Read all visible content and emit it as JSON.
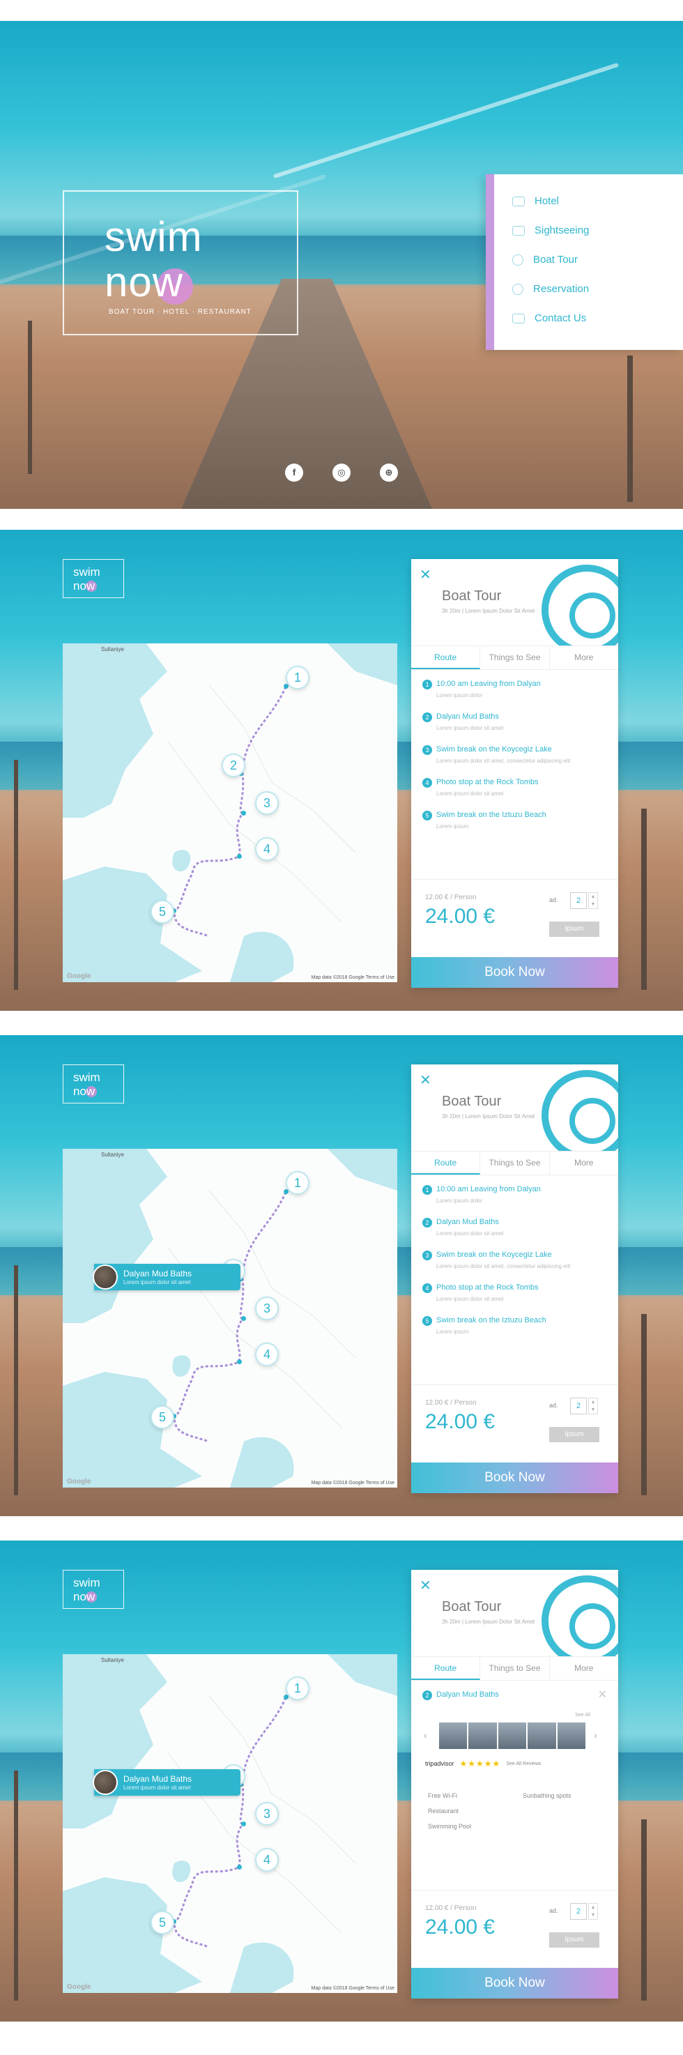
{
  "hero": {
    "logo_line1": "swim",
    "logo_line2": "now",
    "subtitle": "BOAT TOUR · HOTEL · RESTAURANT",
    "menu": [
      {
        "label": "Hotel",
        "icon": "bed-icon"
      },
      {
        "label": "Sightseeing",
        "icon": "binoculars-icon"
      },
      {
        "label": "Boat Tour",
        "icon": "ship-wheel-icon"
      },
      {
        "label": "Reservation",
        "icon": "globe-icon"
      },
      {
        "label": "Contact Us",
        "icon": "mail-icon"
      }
    ],
    "social": [
      {
        "icon": "facebook-icon",
        "glyph": "f"
      },
      {
        "icon": "instagram-icon",
        "glyph": "◎"
      },
      {
        "icon": "tripadvisor-icon",
        "glyph": "⊕"
      }
    ]
  },
  "logo_small": {
    "line1": "swim",
    "line2": "now"
  },
  "map": {
    "place_label": "Sultaniye",
    "footer": "Map data ©2018 Google   Terms of Use",
    "google": "Google",
    "pins": [
      "1",
      "2",
      "3",
      "4",
      "5"
    ],
    "popup": {
      "title": "Dalyan Mud Baths",
      "desc": "Lorem ipsum dolor sit amet"
    }
  },
  "card": {
    "title": "Boat Tour",
    "subtitle": "3h 20m  |  Lorem Ipsum Dolor Sit Amet",
    "tabs": [
      "Route",
      "Things to See",
      "More"
    ],
    "route": [
      {
        "num": "1",
        "title": "10:00 am Leaving from Dalyan",
        "desc": "Lorem ipsum dolor"
      },
      {
        "num": "2",
        "title": "Dalyan Mud Baths",
        "desc": "Lorem ipsum dolor sit amet"
      },
      {
        "num": "3",
        "title": "Swim break on the Koycegiz Lake",
        "desc": "Lorem ipsum dolor sit amet, consectetur adipiscing elit"
      },
      {
        "num": "4",
        "title": "Photo stop at the Rock Tombs",
        "desc": "Lorem ipsum dolor sit amet"
      },
      {
        "num": "5",
        "title": "Swim break on the Iztuzu Beach",
        "desc": "Lorem ipsum"
      }
    ],
    "price_label": "12.00 € / Person",
    "price_total": "24.00 €",
    "quantity": "2",
    "quantity_label": "ad.",
    "ipsum_button": "Ipsum",
    "book_button": "Book Now"
  },
  "detail": {
    "num": "2",
    "title": "Dalyan Mud Baths",
    "see_all": "See All",
    "tripadvisor": "tripadvisor",
    "stars": "★★★★★",
    "reviews": "See All Reviews",
    "amenities": [
      "Free Wi-Fi",
      "Sunbathing spots",
      "Restaurant",
      "Swimming Pool"
    ]
  }
}
